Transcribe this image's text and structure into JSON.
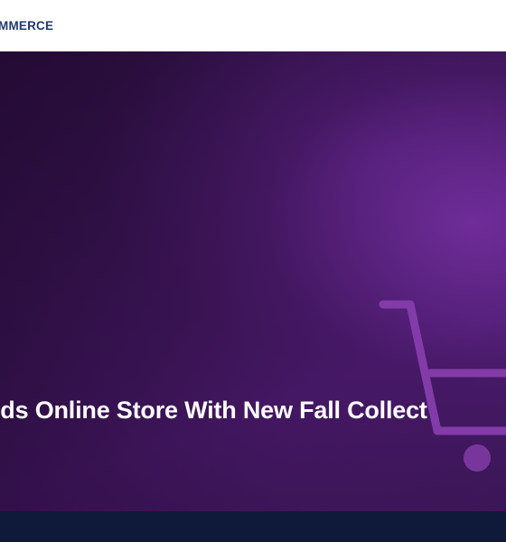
{
  "header": {
    "logo_text": "MMERCE"
  },
  "hero": {
    "title": "nds Online Store With New Fall Collect",
    "icon": "shopping-cart-icon"
  },
  "colors": {
    "header_bg": "#ffffff",
    "logo": "#1f3a6e",
    "hero_purple": "#4a1a6c",
    "cart_outline": "#8a3fb0",
    "bottom_bar": "#0f1a3a"
  }
}
